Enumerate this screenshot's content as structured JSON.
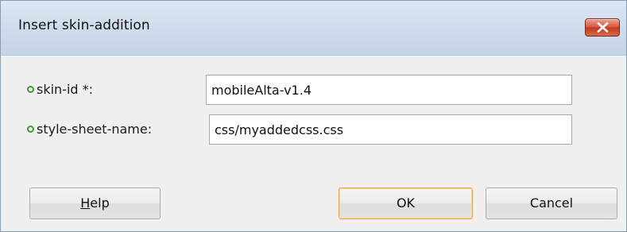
{
  "window": {
    "title": "Insert skin-addition",
    "close_icon": "close-x-icon"
  },
  "form": {
    "fields": [
      {
        "label": "skin-id *:",
        "value": "mobileAlta-v1.4",
        "required": true
      },
      {
        "label": "style-sheet-name:",
        "value": "css/myaddedcss.css",
        "required": true
      }
    ],
    "required_indicator_color": "#3f9a31"
  },
  "buttons": {
    "help": {
      "mnemonic": "H",
      "rest": "elp"
    },
    "ok": "OK",
    "cancel": "Cancel"
  },
  "colors": {
    "close_button": "#c0391e",
    "default_button_border": "#e0a84a"
  }
}
